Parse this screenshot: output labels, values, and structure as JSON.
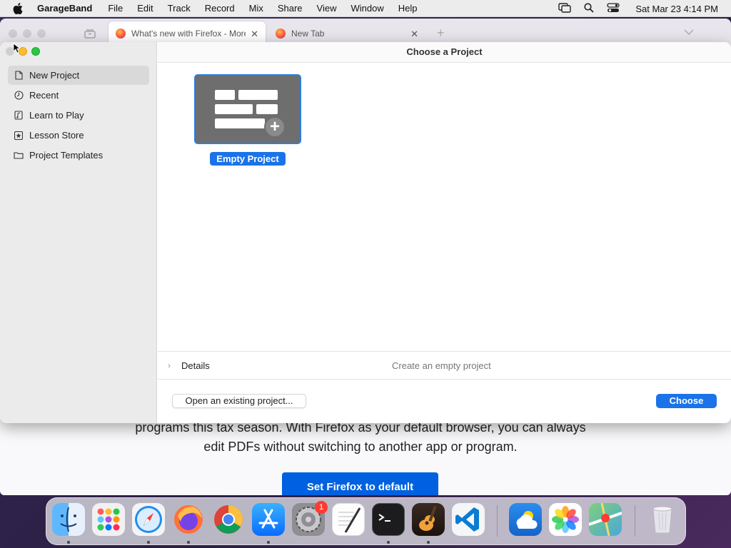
{
  "menubar": {
    "app_name": "GarageBand",
    "items": [
      "File",
      "Edit",
      "Track",
      "Record",
      "Mix",
      "Share",
      "View",
      "Window",
      "Help"
    ],
    "clock": "Sat Mar 23  4:14 PM"
  },
  "firefox": {
    "tabs": [
      {
        "label": "What's new with Firefox - More"
      },
      {
        "label": "New Tab"
      }
    ],
    "body_line_1": "programs this tax season. With Firefox as your default browser, you can always",
    "body_line_2": "edit PDFs without switching to another app or program.",
    "default_button": "Set Firefox to default"
  },
  "garageband": {
    "title": "Choose a Project",
    "sidebar": {
      "items": [
        {
          "label": "New Project",
          "icon": "document-icon",
          "selected": true
        },
        {
          "label": "Recent",
          "icon": "clock-icon",
          "selected": false
        },
        {
          "label": "Learn to Play",
          "icon": "music-note-icon",
          "selected": false
        },
        {
          "label": "Lesson Store",
          "icon": "star-icon",
          "selected": false
        },
        {
          "label": "Project Templates",
          "icon": "folder-icon",
          "selected": false
        }
      ]
    },
    "project": {
      "label": "Empty Project"
    },
    "details": {
      "label": "Details",
      "description": "Create an empty project"
    },
    "open_existing_label": "Open an existing project...",
    "choose_label": "Choose",
    "accent": "#1a73e8"
  },
  "dock": {
    "apps": [
      {
        "name": "Finder",
        "icon": "finder-icon",
        "running": true
      },
      {
        "name": "Launchpad",
        "icon": "launchpad-icon",
        "running": false
      },
      {
        "name": "Safari",
        "icon": "safari-icon",
        "running": true
      },
      {
        "name": "Firefox",
        "icon": "firefox-icon",
        "running": true
      },
      {
        "name": "Chrome",
        "icon": "chrome-icon",
        "running": false
      },
      {
        "name": "App Store",
        "icon": "app-store-icon",
        "running": true
      },
      {
        "name": "System Settings",
        "icon": "settings-icon",
        "running": false,
        "badge": "1"
      },
      {
        "name": "TextEdit",
        "icon": "textedit-icon",
        "running": false
      },
      {
        "name": "Terminal",
        "icon": "terminal-icon",
        "running": true
      },
      {
        "name": "GarageBand",
        "icon": "garageband-icon",
        "running": true
      },
      {
        "name": "VS Code",
        "icon": "vscode-icon",
        "running": false
      },
      {
        "name": "Weather",
        "icon": "weather-icon",
        "running": false
      },
      {
        "name": "Photos",
        "icon": "photos-icon",
        "running": false
      },
      {
        "name": "Maps",
        "icon": "maps-icon",
        "running": false
      },
      {
        "name": "Trash",
        "icon": "trash-icon",
        "running": false
      }
    ]
  }
}
